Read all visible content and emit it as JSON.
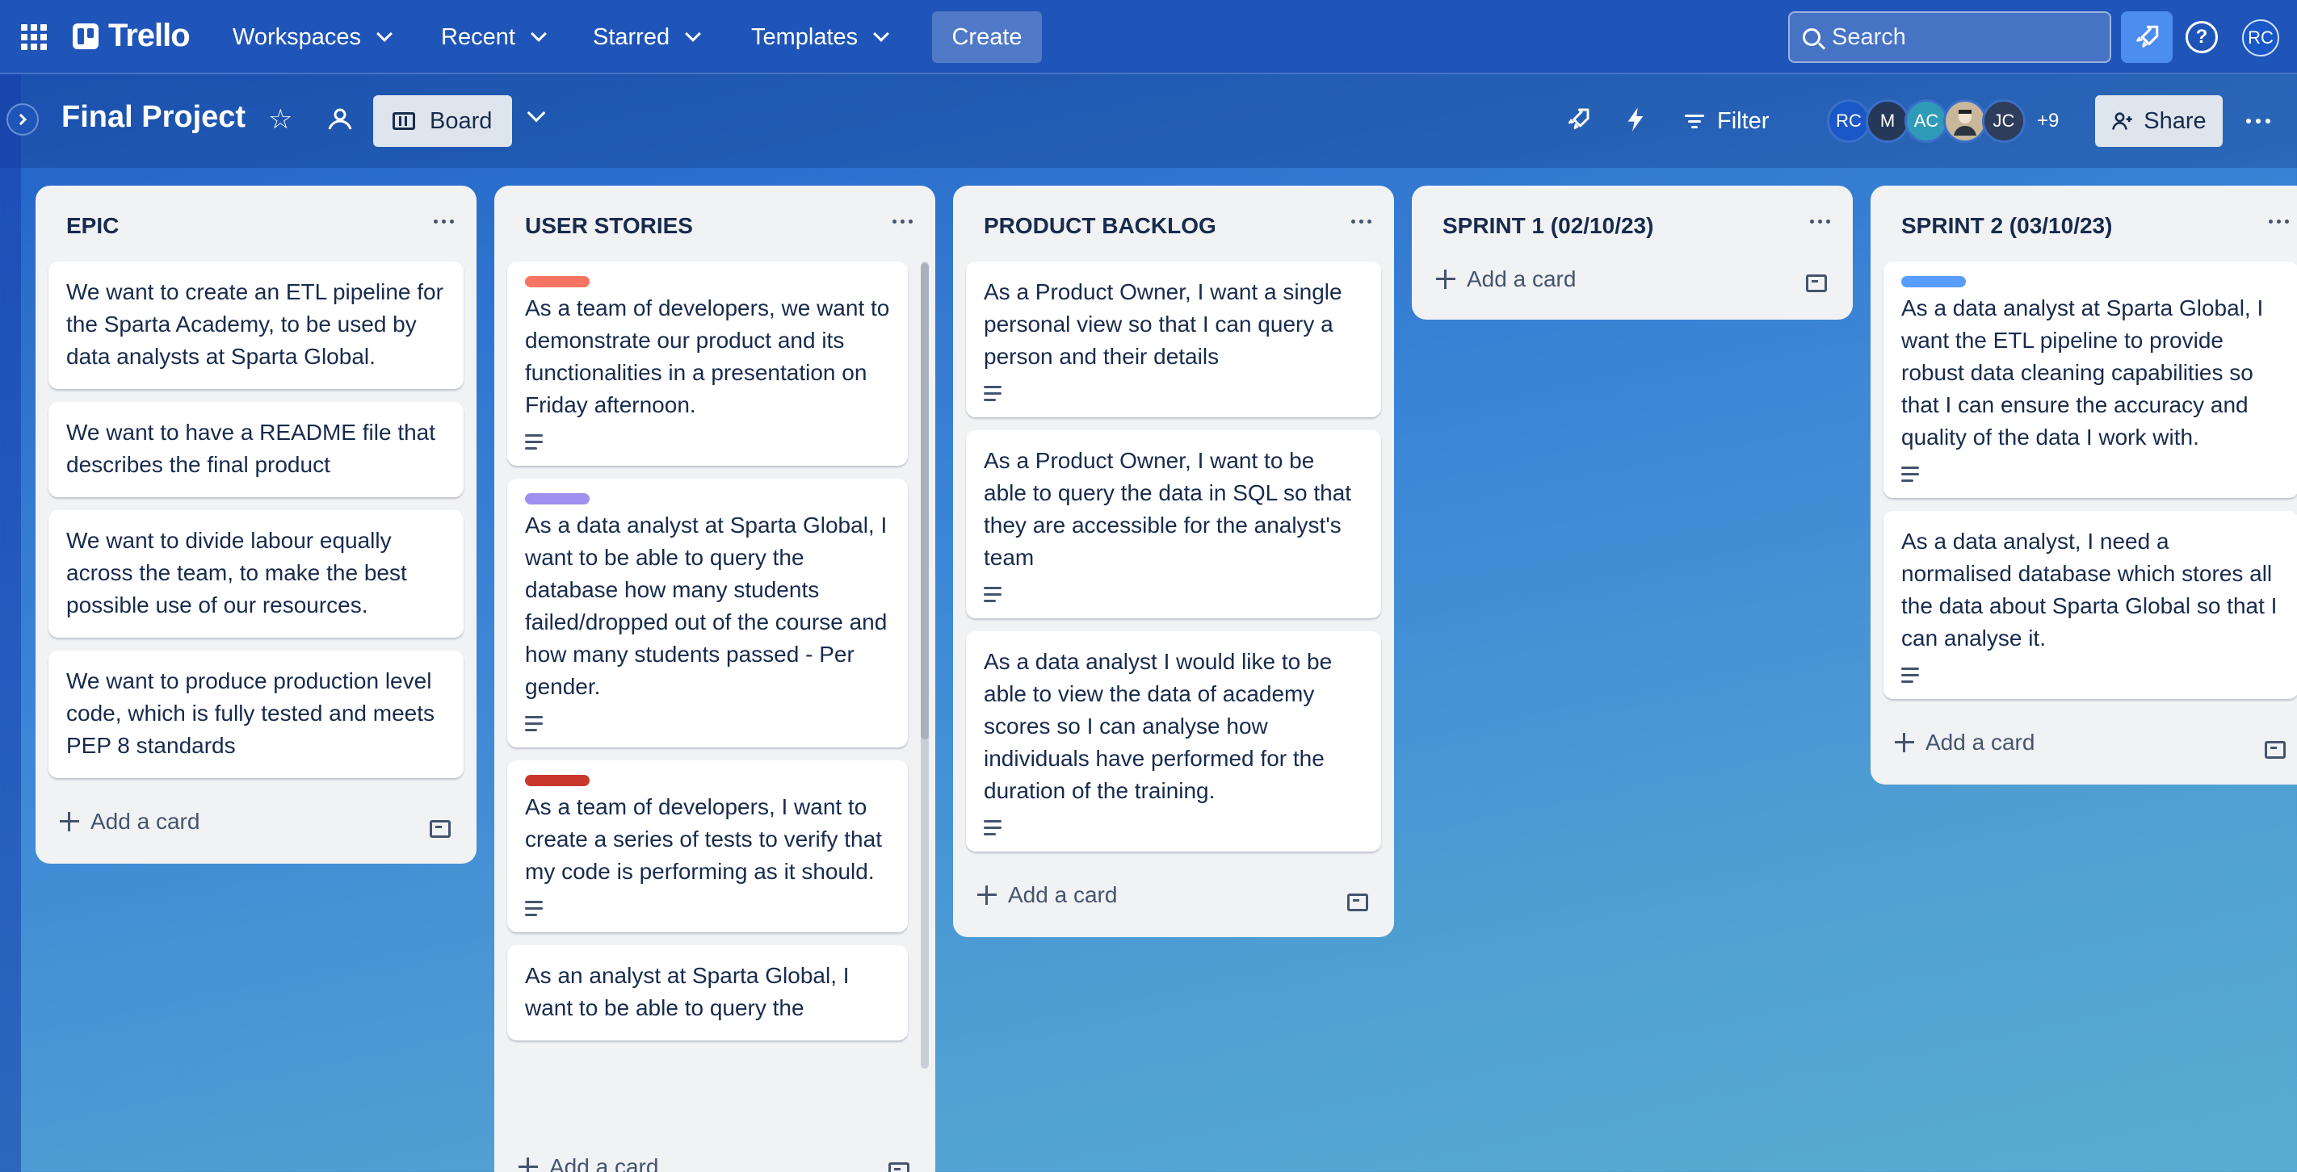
{
  "topnav": {
    "logo_text": "Trello",
    "menus": [
      {
        "label": "Workspaces"
      },
      {
        "label": "Recent"
      },
      {
        "label": "Starred"
      },
      {
        "label": "Templates"
      }
    ],
    "create_label": "Create",
    "search_placeholder": "Search",
    "user_initials": "RC"
  },
  "board": {
    "title": "Final Project",
    "view_label": "Board",
    "filter_label": "Filter",
    "share_label": "Share",
    "members": [
      {
        "initials": "RC",
        "color": "#1a58c7"
      },
      {
        "initials": "M",
        "color": "#253858"
      },
      {
        "initials": "AC",
        "color": "#2f9bb8"
      },
      {
        "initials": "",
        "color": "#c9b79c"
      },
      {
        "initials": "JC",
        "color": "#2e3d5c"
      }
    ],
    "more_members": "+9"
  },
  "lists": [
    {
      "title": "EPIC",
      "cards": [
        {
          "text": "We want to create an ETL pipeline for the Sparta Academy, to be used by data analysts at Sparta Global."
        },
        {
          "text": "We want to have a README file that describes the final product"
        },
        {
          "text": "We want to divide labour equally across the team, to make the best possible use of our resources."
        },
        {
          "text": "We want to produce production level code, which is fully tested and meets PEP 8 standards"
        }
      ],
      "add_label": "Add a card"
    },
    {
      "title": "USER STORIES",
      "cards": [
        {
          "label_color": "#f87462",
          "text": "As a team of developers, we want to demonstrate our product and its functionalities in a presentation on Friday afternoon.",
          "has_description": true
        },
        {
          "label_color": "#9f8fef",
          "text": "As a data analyst at Sparta Global, I want to be able to query the database how many students failed/dropped out of the course and how many students passed - Per gender.",
          "has_description": true
        },
        {
          "label_color": "#c9372c",
          "text": "As a team of developers, I want to create a series of tests to verify that my code is performing as it should.",
          "has_description": true
        },
        {
          "text": "As an analyst at Sparta Global, I want to be able to query the"
        }
      ],
      "add_label": "Add a card"
    },
    {
      "title": "PRODUCT BACKLOG",
      "cards": [
        {
          "text": "As a Product Owner, I want a single personal view so that I can query a person and their details",
          "has_description": true
        },
        {
          "text": "As a Product Owner, I want to be able to query the data in SQL so that they are accessible for the analyst's team",
          "has_description": true
        },
        {
          "text": "As a data analyst I would like to be able to view the data of academy scores so I can analyse how individuals have performed for the duration of the training.",
          "has_description": true
        }
      ],
      "add_label": "Add a card"
    },
    {
      "title": "SPRINT 1 (02/10/23)",
      "cards": [],
      "add_label": "Add a card"
    },
    {
      "title": "SPRINT 2 (03/10/23)",
      "cards": [
        {
          "label_color": "#579dff",
          "text": "As a data analyst at Sparta Global, I want the ETL pipeline to provide robust data cleaning capabilities so that I can ensure the accuracy and quality of the data I work with.",
          "has_description": true
        },
        {
          "text": "As a data analyst, I need a normalised database which stores all the data about Sparta Global so that I can analyse it.",
          "has_description": true
        }
      ],
      "add_label": "Add a card"
    }
  ]
}
